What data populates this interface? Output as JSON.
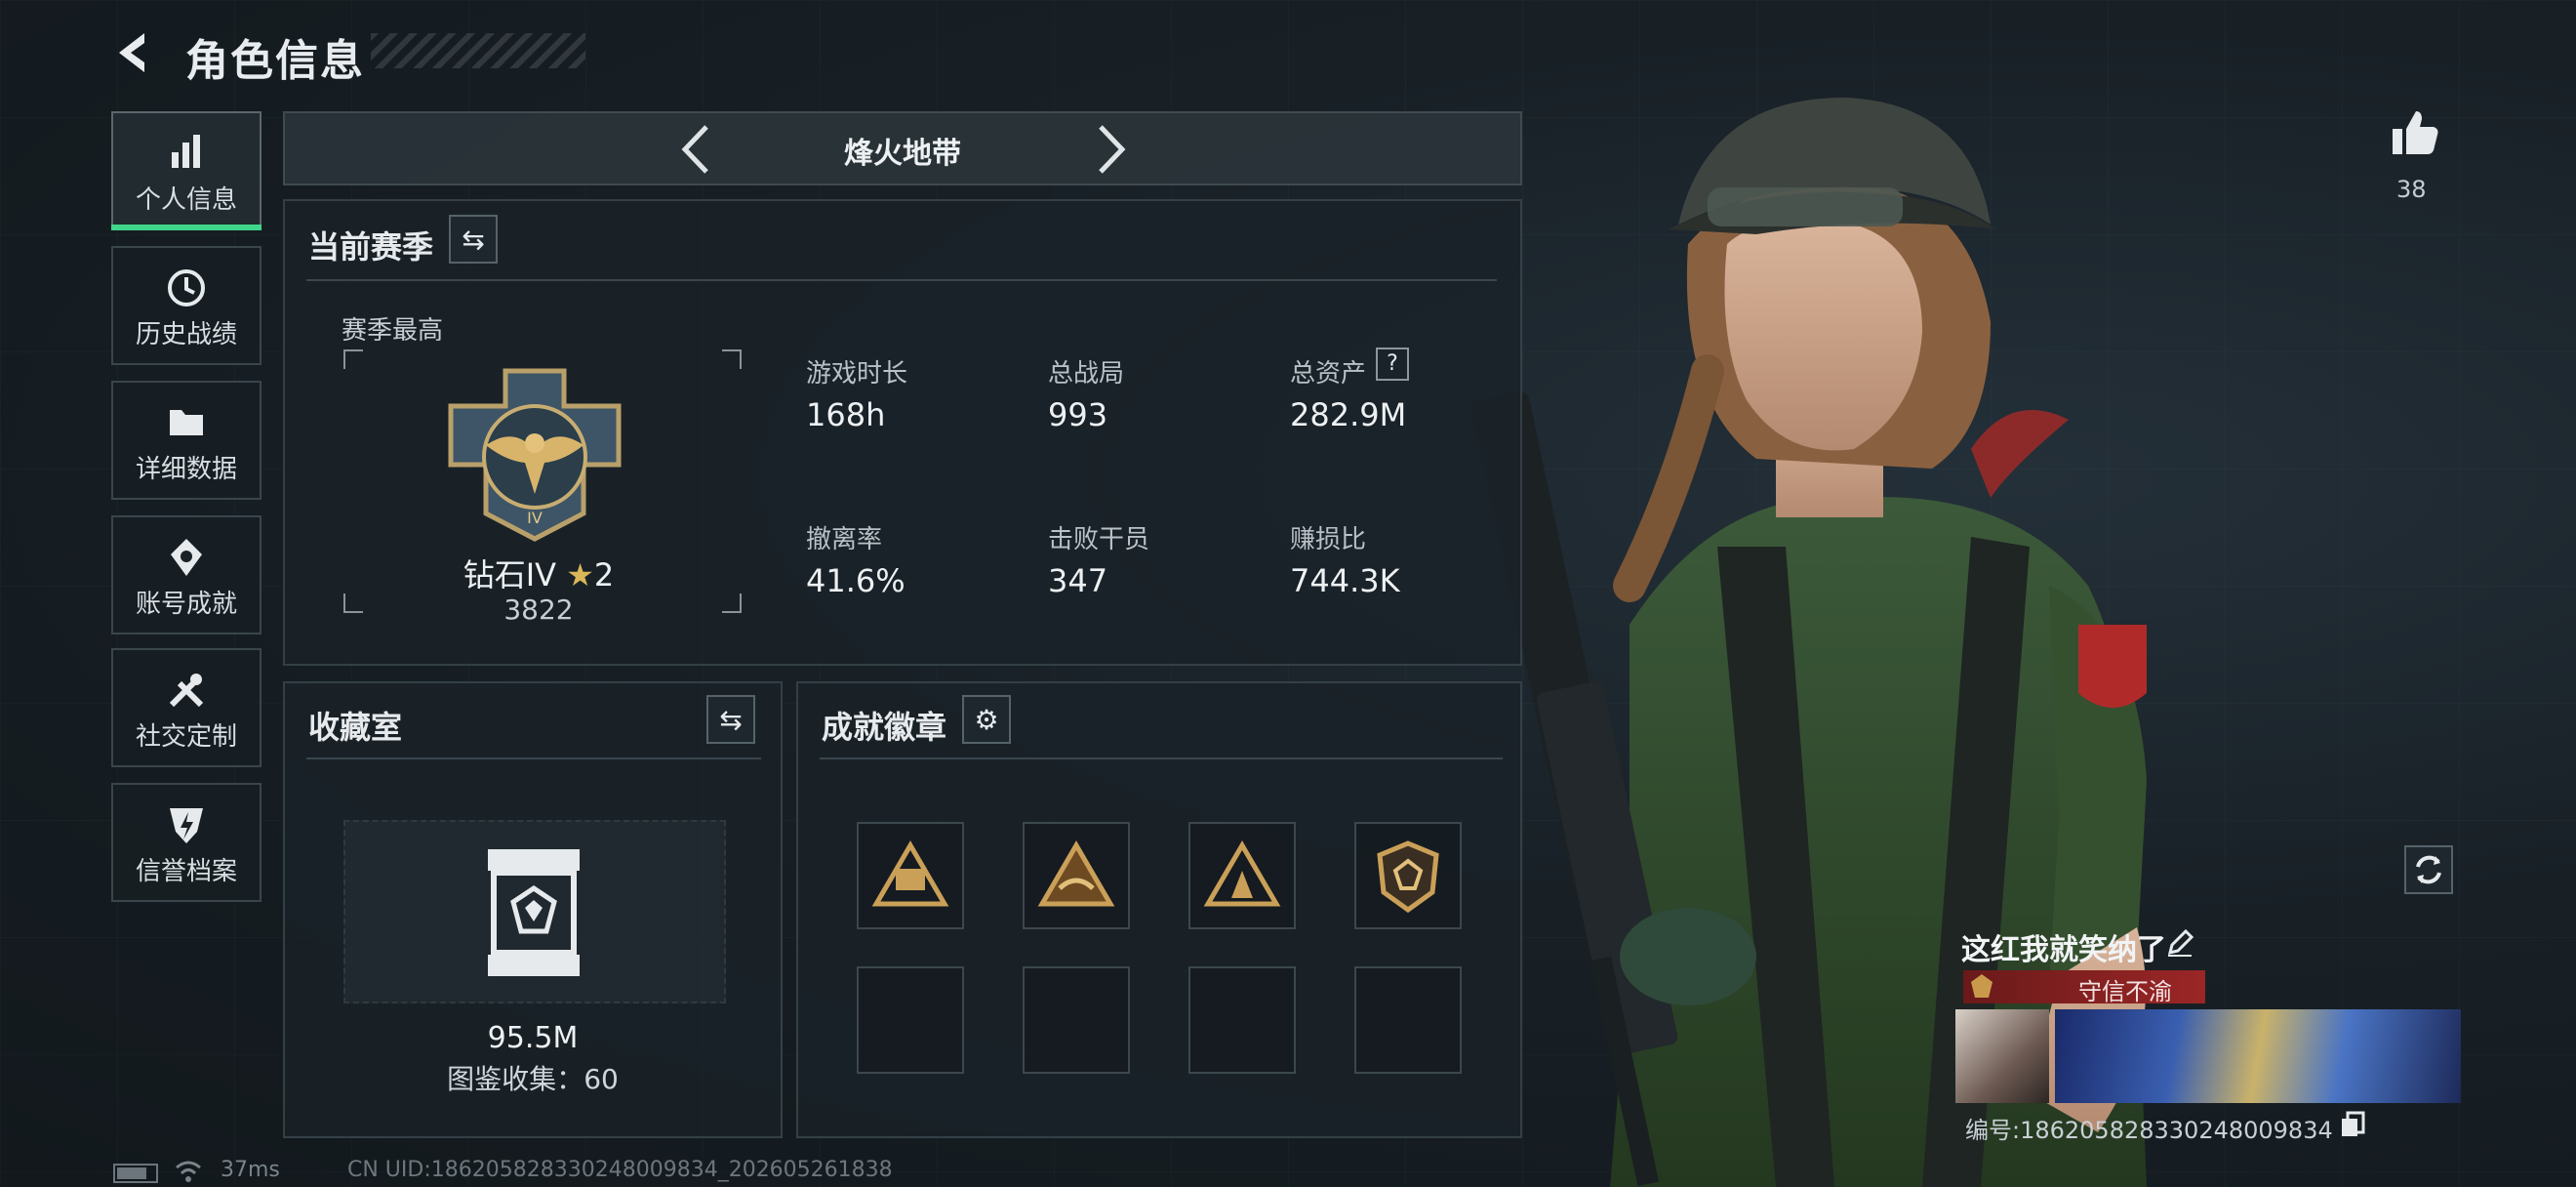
{
  "header": {
    "title": "角色信息"
  },
  "sidebar": {
    "items": [
      {
        "label": "个人信息",
        "icon": "bar-chart-icon",
        "active": true
      },
      {
        "label": "历史战绩",
        "icon": "history-icon"
      },
      {
        "label": "详细数据",
        "icon": "folder-icon"
      },
      {
        "label": "账号成就",
        "icon": "medal-icon"
      },
      {
        "label": "社交定制",
        "icon": "tools-icon"
      },
      {
        "label": "信誉档案",
        "icon": "credit-shield-icon"
      }
    ]
  },
  "mode_selector": {
    "label": "烽火地带"
  },
  "season": {
    "section_title": "当前赛季",
    "peak_label": "赛季最高",
    "rank_name": "钻石IV",
    "rank_stars": "2",
    "rank_points": "3822",
    "stats": [
      {
        "label": "游戏时长",
        "value": "168h"
      },
      {
        "label": "总战局",
        "value": "993"
      },
      {
        "label": "总资产",
        "value": "282.9M",
        "help": "?"
      },
      {
        "label": "撤离率",
        "value": "41.6%"
      },
      {
        "label": "击败干员",
        "value": "347"
      },
      {
        "label": "赚损比",
        "value": "744.3K"
      }
    ]
  },
  "collection": {
    "title": "收藏室",
    "value": "95.5M",
    "catalog_label": "图鉴收集：",
    "catalog_value": "60"
  },
  "achievements": {
    "title": "成就徽章"
  },
  "likes": {
    "count": "38"
  },
  "player": {
    "name": "这红我就笑纳了",
    "reputation_tag": "守信不渝",
    "id_line": "编号:18620582833024800983​4"
  },
  "status_bar": {
    "latency": "37ms",
    "uid": "CN UID:18620582833024800983​4_202605261838"
  },
  "colors": {
    "accent": "#3fd68c",
    "tag_red": "#8c1f1f"
  }
}
